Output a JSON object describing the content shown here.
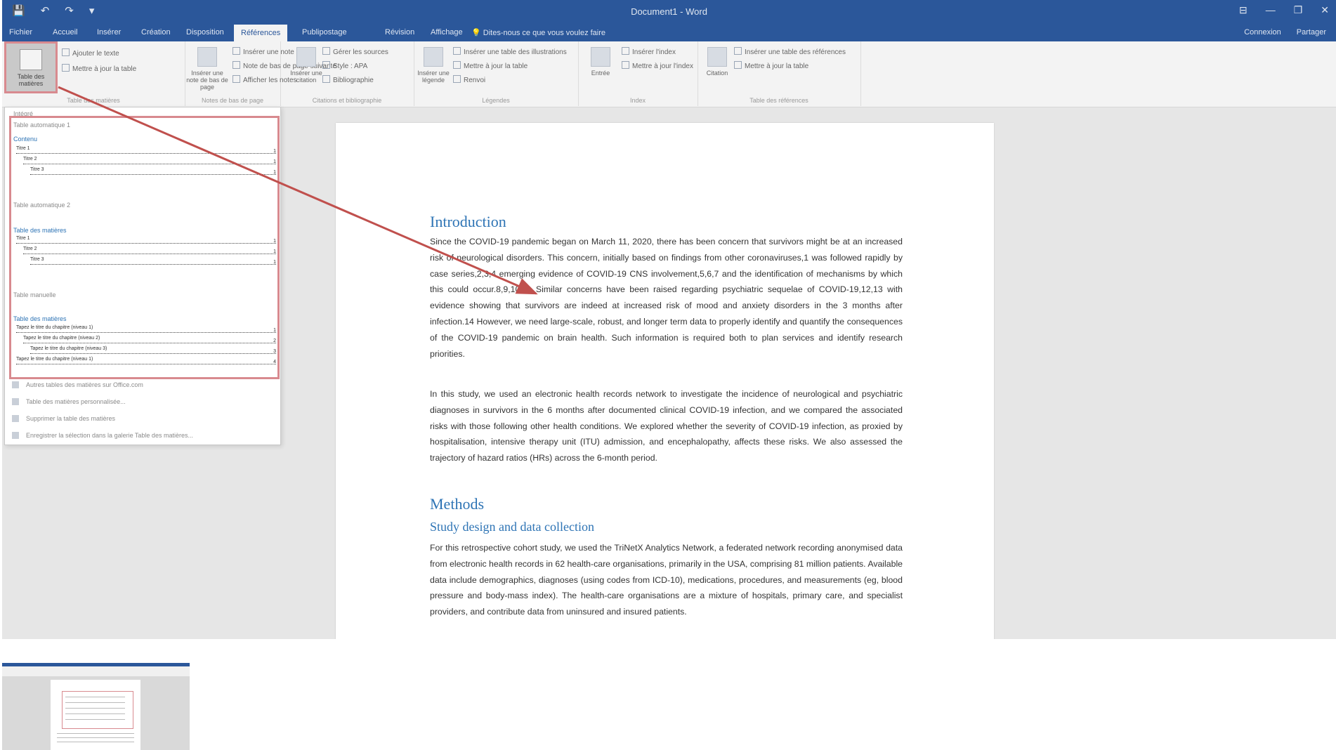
{
  "titlebar": {
    "title": "Document1 - Word",
    "qat": {
      "save": "💾",
      "undo": "↶",
      "redo": "↷",
      "more": "▾"
    },
    "controls": {
      "ribbon_options": "⊟",
      "minimize": "—",
      "restore": "❐",
      "close": "✕"
    }
  },
  "tabs": [
    "Accueil",
    "Insérer",
    "Création",
    "Disposition",
    "Références",
    "Publipostage",
    "Révision",
    "Affichage"
  ],
  "active_tab": "Références",
  "tell_me": "Dites-nous ce que vous voulez faire",
  "header_links": {
    "signin": "Connexion",
    "share": "Partager"
  },
  "ribbon": {
    "toc": {
      "big_label": "Table des matières",
      "add_text": "Ajouter le texte",
      "update_table": "Mettre à jour la table",
      "group": "Table des matières"
    },
    "footnotes": {
      "big_label": "Insérer une note de bas de page",
      "insert_endnote": "Insérer une note de fin",
      "next_footnote": "Note de bas de page suivante",
      "show_notes": "Afficher les notes",
      "group": "Notes de bas de page"
    },
    "citations": {
      "big_label": "Insérer une citation",
      "manage_sources": "Gérer les sources",
      "style": "Style : APA",
      "bibliography": "Bibliographie",
      "group": "Citations et bibliographie"
    },
    "captions": {
      "big_label": "Insérer une légende",
      "insert_table_figures": "Insérer une table des illustrations",
      "update_table": "Mettre à jour la table",
      "cross_reference": "Renvoi",
      "group": "Légendes"
    },
    "index": {
      "big_label": "Entrée",
      "insert_index": "Insérer l'index",
      "update_index": "Mettre à jour l'index",
      "group": "Index"
    },
    "authorities": {
      "big_label": "Citation",
      "insert_table": "Insérer une table des références",
      "update_table": "Mettre à jour la table",
      "group": "Table des références"
    }
  },
  "toc_menu": {
    "builtin": "Intégré",
    "auto1": {
      "title": "Table automatique 1",
      "heading": "Contenu",
      "entries": [
        {
          "text": "Titre 1",
          "page": "1"
        },
        {
          "text": "Titre 2",
          "page": "1"
        },
        {
          "text": "Titre 3",
          "page": "1"
        }
      ]
    },
    "auto2": {
      "title": "Table automatique 2",
      "heading": "Table des matières",
      "entries": [
        {
          "text": "Titre 1",
          "page": "1"
        },
        {
          "text": "Titre 2",
          "page": "1"
        },
        {
          "text": "Titre 3",
          "page": "1"
        }
      ]
    },
    "manual": {
      "title": "Table manuelle",
      "heading": "Table des matières",
      "entries": [
        {
          "text": "Tapez le titre du chapitre (niveau 1)",
          "page": "1"
        },
        {
          "text": "Tapez le titre du chapitre (niveau 2)",
          "page": "2"
        },
        {
          "text": "Tapez le titre du chapitre (niveau 3)",
          "page": "3"
        },
        {
          "text": "Tapez le titre du chapitre (niveau 1)",
          "page": "4"
        }
      ]
    },
    "commands": [
      "Autres tables des matières sur Office.com",
      "Table des matières personnalisée...",
      "Supprimer la table des matières",
      "Enregistrer la sélection dans la galerie Table des matières..."
    ]
  },
  "document": {
    "heading_intro": "Introduction",
    "para1": "Since the COVID-19 pandemic began on March 11, 2020, there has been concern that survivors might be at an increased risk of neurological disorders. This concern, initially based on findings from other coronaviruses,1 was followed rapidly by case series,2,3,4 emerging evidence of COVID-19 CNS involvement,5,6,7 and the identification of mechanisms by which this could occur.8,9,10,11 Similar concerns have been raised regarding psychiatric sequelae of COVID-19,12,13 with evidence showing that survivors are indeed at increased risk of mood and anxiety disorders in the 3 months after infection.14 However, we need large-scale, robust, and longer term data to properly identify and quantify the consequences of the COVID-19 pandemic on brain health. Such information is required both to plan services and identify research priorities.",
    "para2": "In this study, we used an electronic health records network to investigate the incidence of neurological and psychiatric diagnoses in survivors in the 6 months after documented clinical COVID-19 infection, and we compared the associated risks with those following other health conditions. We explored whether the severity of COVID-19 infection, as proxied by hospitalisation, intensive therapy unit (ITU) admission, and encephalopathy, affects these risks. We also assessed the trajectory of hazard ratios (HRs) across the 6-month period.",
    "heading_methods": "Methods",
    "heading_study": "Study design and data collection",
    "para3": "For this retrospective cohort study, we used the TriNetX Analytics Network, a federated network recording anonymised data from electronic health records in 62 health-care organisations, primarily in the USA, comprising 81 million patients. Available data include demographics, diagnoses (using codes from ICD-10), medications, procedures, and measurements (eg, blood pressure and body-mass index). The health-care organisations are a mixture of hospitals, primary care, and specialist providers, and contribute data from uninsured and insured patients."
  }
}
